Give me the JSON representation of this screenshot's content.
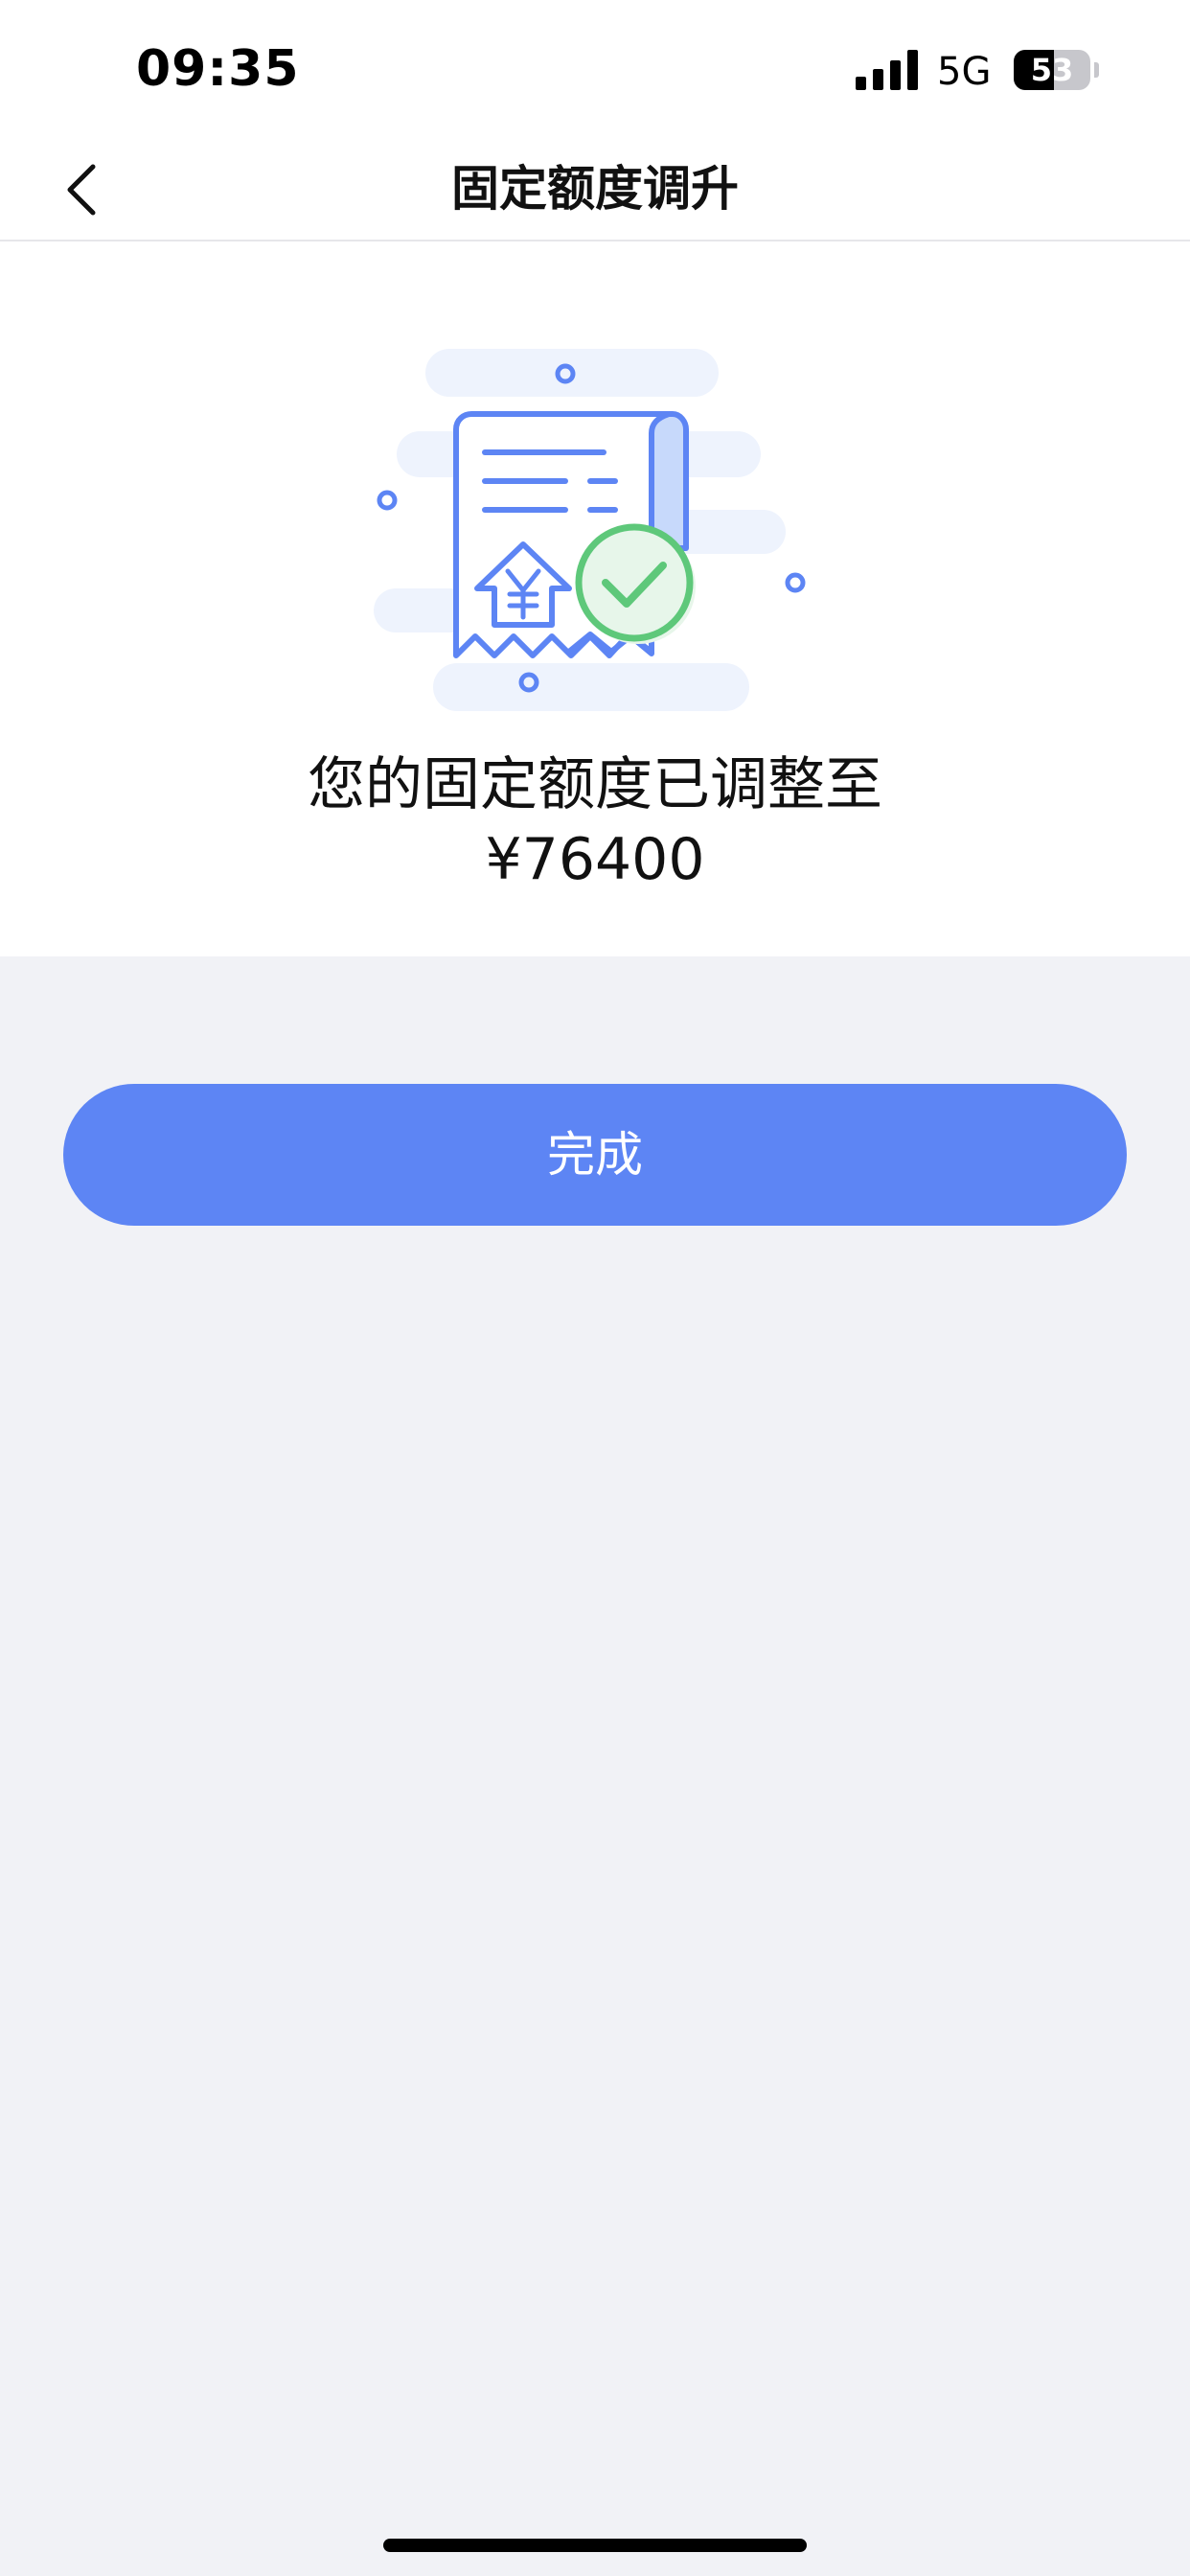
{
  "status_bar": {
    "time": "09:35",
    "network": "5G",
    "battery_level": "53",
    "battery_fraction": 0.53
  },
  "nav": {
    "back_icon": "chevron-left-icon",
    "title": "固定额度调升"
  },
  "result": {
    "illustration_icon": "receipt-success-icon",
    "message_line1": "您的固定额度已调整至",
    "message_line2": "¥76400"
  },
  "actions": {
    "done_label": "完成"
  },
  "colors": {
    "accent": "#5d85f4",
    "success": "#5ec87a",
    "page_background": "#f1f2f6"
  }
}
